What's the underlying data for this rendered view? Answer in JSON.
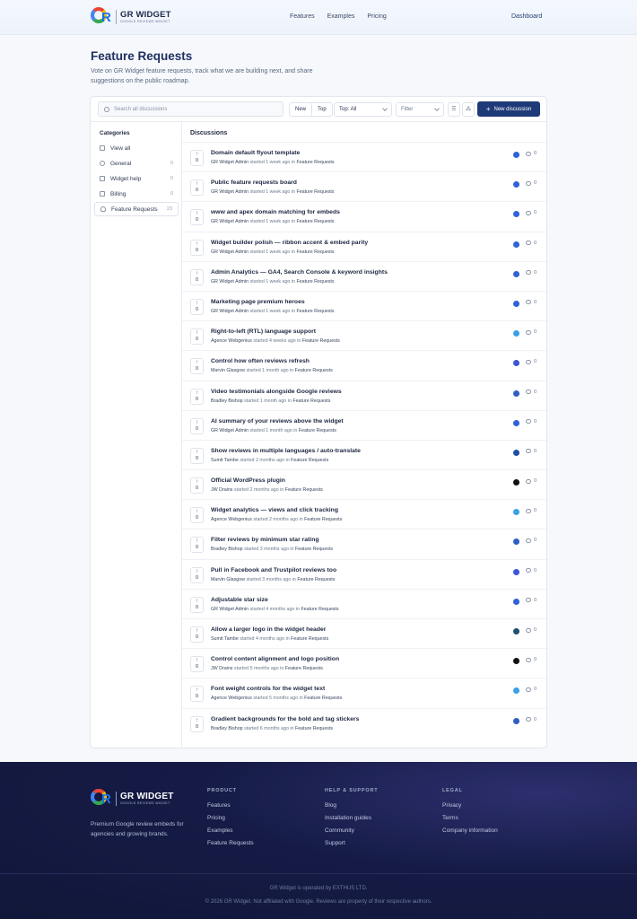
{
  "header": {
    "logo_title": "GR WIDGET",
    "logo_sub": "GOOGLE REVIEWS WIDGET",
    "nav": [
      "Features",
      "Examples",
      "Pricing"
    ],
    "dashboard": "Dashboard"
  },
  "page": {
    "title": "Feature Requests",
    "description": "Vote on GR Widget feature requests, track what we are building next, and share suggestions on the public roadmap."
  },
  "toolbar": {
    "search_placeholder": "Search all discussions",
    "sort_new": "New",
    "sort_top": "Top",
    "top_select": "Top: All",
    "filter_select": "Filter",
    "new_button": "New discussion"
  },
  "sidebar": {
    "heading": "Categories",
    "items": [
      {
        "label": "View all",
        "count": ""
      },
      {
        "label": "General",
        "count": "0"
      },
      {
        "label": "Widget help",
        "count": "0"
      },
      {
        "label": "Billing",
        "count": "0"
      },
      {
        "label": "Feature Requests",
        "count": "23"
      }
    ]
  },
  "list": {
    "heading": "Discussions",
    "rows": [
      {
        "title": "Domain default flyout template",
        "author": "GR Widget Admin",
        "when": "started 1 week ago in",
        "category": "Feature Requests",
        "votes": "0",
        "comments": "0",
        "avatar_color": "#2f62d8"
      },
      {
        "title": "Public feature requests board",
        "author": "GR Widget Admin",
        "when": "started 1 week ago in",
        "category": "Feature Requests",
        "votes": "0",
        "comments": "0",
        "avatar_color": "#2f62d8"
      },
      {
        "title": "www and apex domain matching for embeds",
        "author": "GR Widget Admin",
        "when": "started 1 week ago in",
        "category": "Feature Requests",
        "votes": "0",
        "comments": "0",
        "avatar_color": "#2f62d8"
      },
      {
        "title": "Widget builder polish — ribbon accent & embed parity",
        "author": "GR Widget Admin",
        "when": "started 1 week ago in",
        "category": "Feature Requests",
        "votes": "0",
        "comments": "0",
        "avatar_color": "#2f62d8"
      },
      {
        "title": "Admin Analytics — GA4, Search Console & keyword insights",
        "author": "GR Widget Admin",
        "when": "started 1 week ago in",
        "category": "Feature Requests",
        "votes": "0",
        "comments": "0",
        "avatar_color": "#2f62d8"
      },
      {
        "title": "Marketing page premium heroes",
        "author": "GR Widget Admin",
        "when": "started 1 week ago in",
        "category": "Feature Requests",
        "votes": "0",
        "comments": "0",
        "avatar_color": "#2f62d8"
      },
      {
        "title": "Right-to-left (RTL) language support",
        "author": "Agence Webgenius",
        "when": "started 4 weeks ago in",
        "category": "Feature Requests",
        "votes": "0",
        "comments": "0",
        "avatar_color": "#3aa0e8"
      },
      {
        "title": "Control how often reviews refresh",
        "author": "Marvin Glasgow",
        "when": "started 1 month ago in",
        "category": "Feature Requests",
        "votes": "0",
        "comments": "0",
        "avatar_color": "#3b55d9"
      },
      {
        "title": "Video testimonials alongside Google reviews",
        "author": "Bradley Bishop",
        "when": "started 1 month ago in",
        "category": "Feature Requests",
        "votes": "0",
        "comments": "0",
        "avatar_color": "#2f5fc4"
      },
      {
        "title": "AI summary of your reviews above the widget",
        "author": "GR Widget Admin",
        "when": "started 1 month ago in",
        "category": "Feature Requests",
        "votes": "0",
        "comments": "0",
        "avatar_color": "#2f62d8"
      },
      {
        "title": "Show reviews in multiple languages / auto-translate",
        "author": "Sumit Tambe",
        "when": "started 2 months ago in",
        "category": "Feature Requests",
        "votes": "0",
        "comments": "0",
        "avatar_color": "#1e4fa3"
      },
      {
        "title": "Official WordPress plugin",
        "author": "JW Drains",
        "when": "started 2 months ago in",
        "category": "Feature Requests",
        "votes": "0",
        "comments": "0",
        "avatar_color": "#111111"
      },
      {
        "title": "Widget analytics — views and click tracking",
        "author": "Agence Webgenius",
        "when": "started 2 months ago in",
        "category": "Feature Requests",
        "votes": "0",
        "comments": "0",
        "avatar_color": "#3aa0e8"
      },
      {
        "title": "Filter reviews by minimum star rating",
        "author": "Bradley Bishop",
        "when": "started 3 months ago in",
        "category": "Feature Requests",
        "votes": "0",
        "comments": "0",
        "avatar_color": "#2f5fc4"
      },
      {
        "title": "Pull in Facebook and Trustpilot reviews too",
        "author": "Marvin Glasgow",
        "when": "started 3 months ago in",
        "category": "Feature Requests",
        "votes": "0",
        "comments": "0",
        "avatar_color": "#3b55d9"
      },
      {
        "title": "Adjustable star size",
        "author": "GR Widget Admin",
        "when": "started 4 months ago in",
        "category": "Feature Requests",
        "votes": "0",
        "comments": "0",
        "avatar_color": "#2f62d8"
      },
      {
        "title": "Allow a larger logo in the widget header",
        "author": "Sumit Tambe",
        "when": "started 4 months ago in",
        "category": "Feature Requests",
        "votes": "0",
        "comments": "0",
        "avatar_color": "#1e4f6e"
      },
      {
        "title": "Control content alignment and logo position",
        "author": "JW Drains",
        "when": "started 5 months ago in",
        "category": "Feature Requests",
        "votes": "0",
        "comments": "0",
        "avatar_color": "#111111"
      },
      {
        "title": "Font weight controls for the widget text",
        "author": "Agence Webgenius",
        "when": "started 5 months ago in",
        "category": "Feature Requests",
        "votes": "0",
        "comments": "0",
        "avatar_color": "#3aa0e8"
      },
      {
        "title": "Gradient backgrounds for the bold and tag stickers",
        "author": "Bradley Bishop",
        "when": "started 6 months ago in",
        "category": "Feature Requests",
        "votes": "0",
        "comments": "0",
        "avatar_color": "#2f5fc4"
      }
    ]
  },
  "footer": {
    "logo_title": "GR WIDGET",
    "logo_sub": "GOOGLE REVIEWS WIDGET",
    "tagline": "Premium Google review embeds for agencies and growing brands.",
    "columns": [
      {
        "heading": "PRODUCT",
        "links": [
          "Features",
          "Pricing",
          "Examples",
          "Feature Requests"
        ]
      },
      {
        "heading": "HELP & SUPPORT",
        "links": [
          "Blog",
          "Installation guides",
          "Community",
          "Support"
        ]
      },
      {
        "heading": "LEGAL",
        "links": [
          "Privacy",
          "Terms",
          "Company information"
        ]
      }
    ],
    "operated_by": "GR Widget is operated by EXTHUS LTD.",
    "copyright": "© 2026 GR Widget. Not affiliated with Google. Reviews are property of their respective authors."
  }
}
